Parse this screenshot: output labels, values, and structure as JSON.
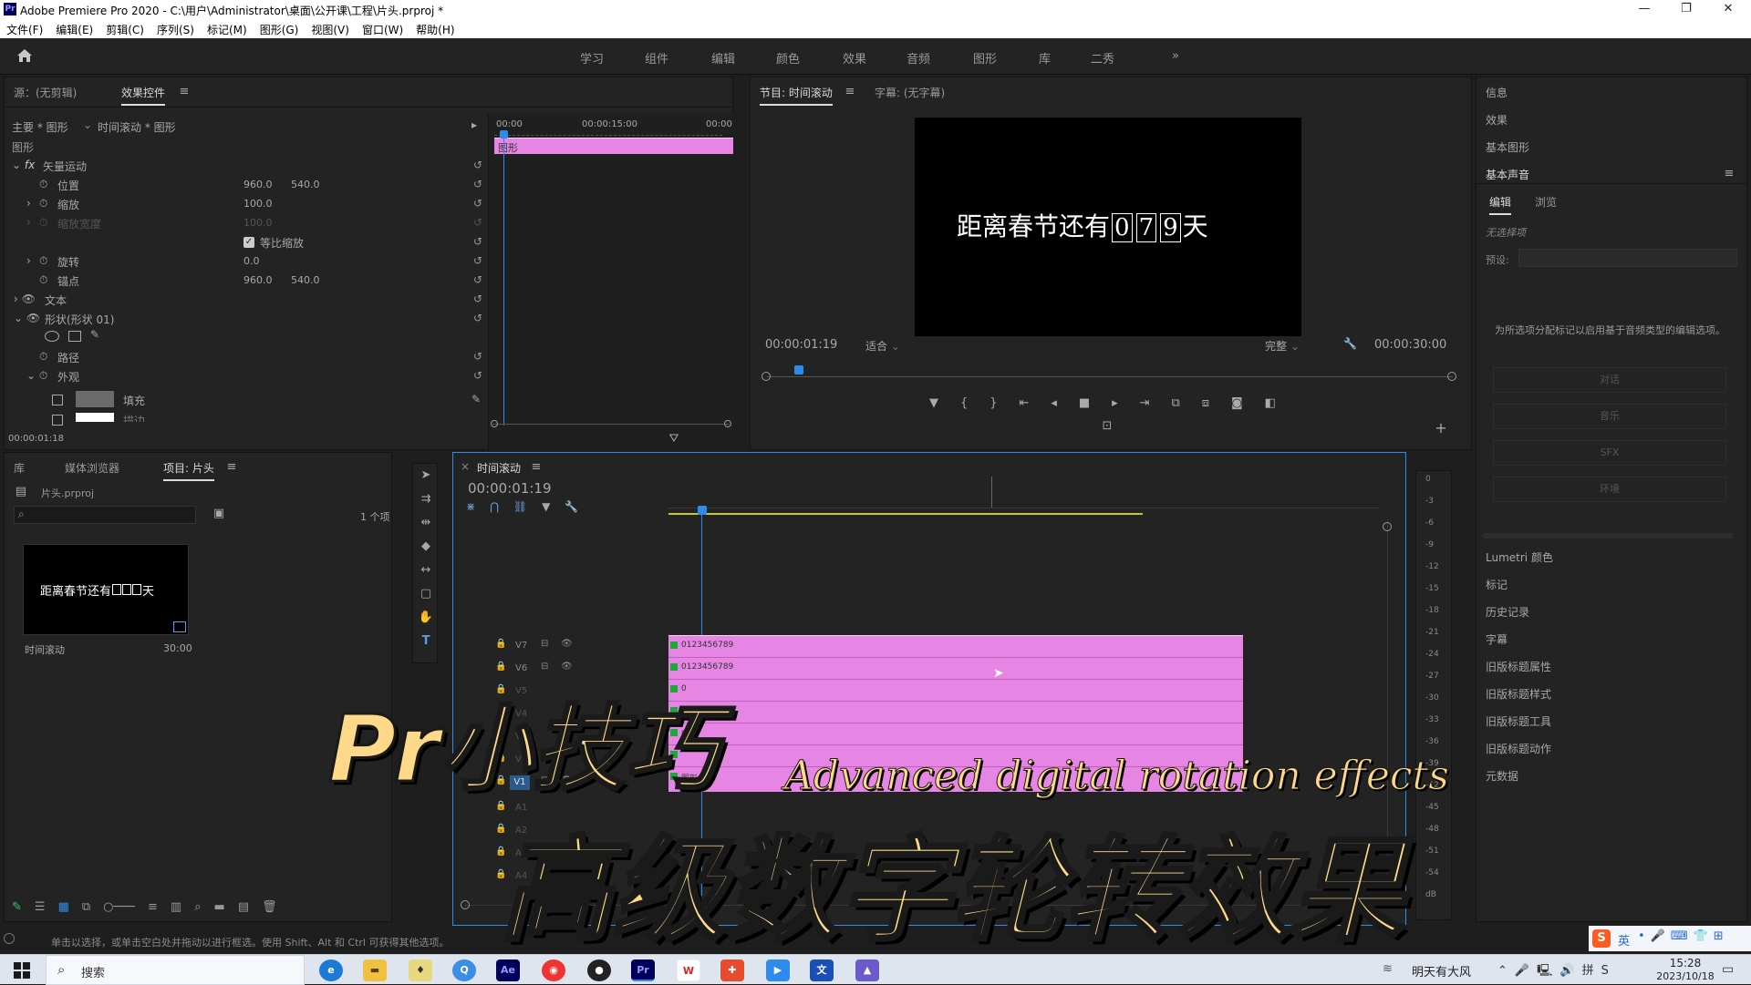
{
  "window": {
    "title": "Adobe Premiere Pro 2020 - C:\\用户\\Administrator\\桌面\\公开课\\工程\\片头.prproj *",
    "minimize": "—",
    "maximize": "❐",
    "close": "✕"
  },
  "menu": [
    "文件(F)",
    "编辑(E)",
    "剪辑(C)",
    "序列(S)",
    "标记(M)",
    "图形(G)",
    "视图(V)",
    "窗口(W)",
    "帮助(H)"
  ],
  "workspaces": [
    "学习",
    "组件",
    "编辑",
    "颜色",
    "效果",
    "音频",
    "图形",
    "库",
    "二秀",
    "»"
  ],
  "effect_controls": {
    "tab_source": "源：(无剪辑)",
    "tab_effect": "效果控件",
    "master": "主要 * 图形",
    "sequence_clip": "时间滚动 * 图形",
    "mini_timeline": {
      "t0": "00:00",
      "t1": "00:00:15:00",
      "t2": "00:00",
      "clip": "图形"
    },
    "section": "图形",
    "vector_motion": "矢量运动",
    "position_label": "位置",
    "position_x": "960.0",
    "position_y": "540.0",
    "scale_label": "缩放",
    "scale_value": "100.0",
    "scale_width_label": "缩放宽度",
    "scale_width_value": "100.0",
    "uniform_scale": "等比缩放",
    "rotation_label": "旋转",
    "rotation_value": "0.0",
    "anchor_label": "锚点",
    "anchor_x": "960.0",
    "anchor_y": "540.0",
    "text_label": "文本",
    "shape_label": "形状(形状 01)",
    "path_label": "路径",
    "appearance_label": "外观",
    "fill_label": "填充",
    "stroke_label": "描边",
    "timecode": "00:00:01:18"
  },
  "program": {
    "tab": "节目: 时间滚动",
    "captions_tab": "字幕: (无字幕)",
    "frame_text": "距离春节还有",
    "digits": [
      "0",
      "7",
      "9"
    ],
    "frame_suffix": "天",
    "timecode": "00:00:01:19",
    "fit": "适合",
    "quality": "完整",
    "duration": "00:00:30:00"
  },
  "project": {
    "tab_lib": "库",
    "tab_media": "媒体浏览器",
    "tab_project": "项目: 片头",
    "file": "片头.prproj",
    "count": "1 个项",
    "thumb_text": "距离春节还有",
    "thumb_suffix": "天",
    "item_name": "时间滚动",
    "item_duration": "30:00"
  },
  "timeline": {
    "tab": "时间滚动",
    "timecode": "00:00:01:19",
    "tracks": [
      "V7",
      "V6",
      "V5",
      "V4",
      "V3",
      "V2",
      "V1",
      "A1",
      "A2",
      "A3",
      "A4"
    ],
    "clip_labels": [
      "0123456789",
      "0123456789",
      "0",
      "",
      "图",
      "",
      "图形"
    ]
  },
  "meter": {
    "ticks": [
      "0",
      "-3",
      "-6",
      "-9",
      "-12",
      "-15",
      "-18",
      "-21",
      "-24",
      "-27",
      "-30",
      "-33",
      "-36",
      "-39",
      "-42",
      "-45",
      "-48",
      "-51",
      "-54",
      "dB"
    ]
  },
  "right_panel": {
    "info": "信息",
    "effects": "效果",
    "essential_graphics": "基本图形",
    "essential_sound": "基本声音",
    "tab_edit": "编辑",
    "tab_browse": "浏览",
    "no_selection": "无选择项",
    "preset": "预设:",
    "hint": "为所选项分配标记以启用基于音频类型的编辑选项。",
    "buttons": [
      "对话",
      "音乐",
      "SFX",
      "环境"
    ],
    "items": [
      "Lumetri 颜色",
      "标记",
      "历史记录",
      "字幕",
      "旧版标题属性",
      "旧版标题样式",
      "旧版标题工具",
      "旧版标题动作",
      "元数据"
    ]
  },
  "status": "单击以选择，或单击空白处并拖动以进行框选。使用 Shift、Alt 和 Ctrl 可获得其他选项。",
  "overlay": {
    "title1": "Pr小技巧",
    "subtitle_en": "Advanced digital rotation effects",
    "title2": "高级数字轮转效果"
  },
  "taskbar": {
    "search": "搜索",
    "weather": "明天有大风",
    "time": "15:28",
    "date": "2023/10/18",
    "ime": "英"
  }
}
